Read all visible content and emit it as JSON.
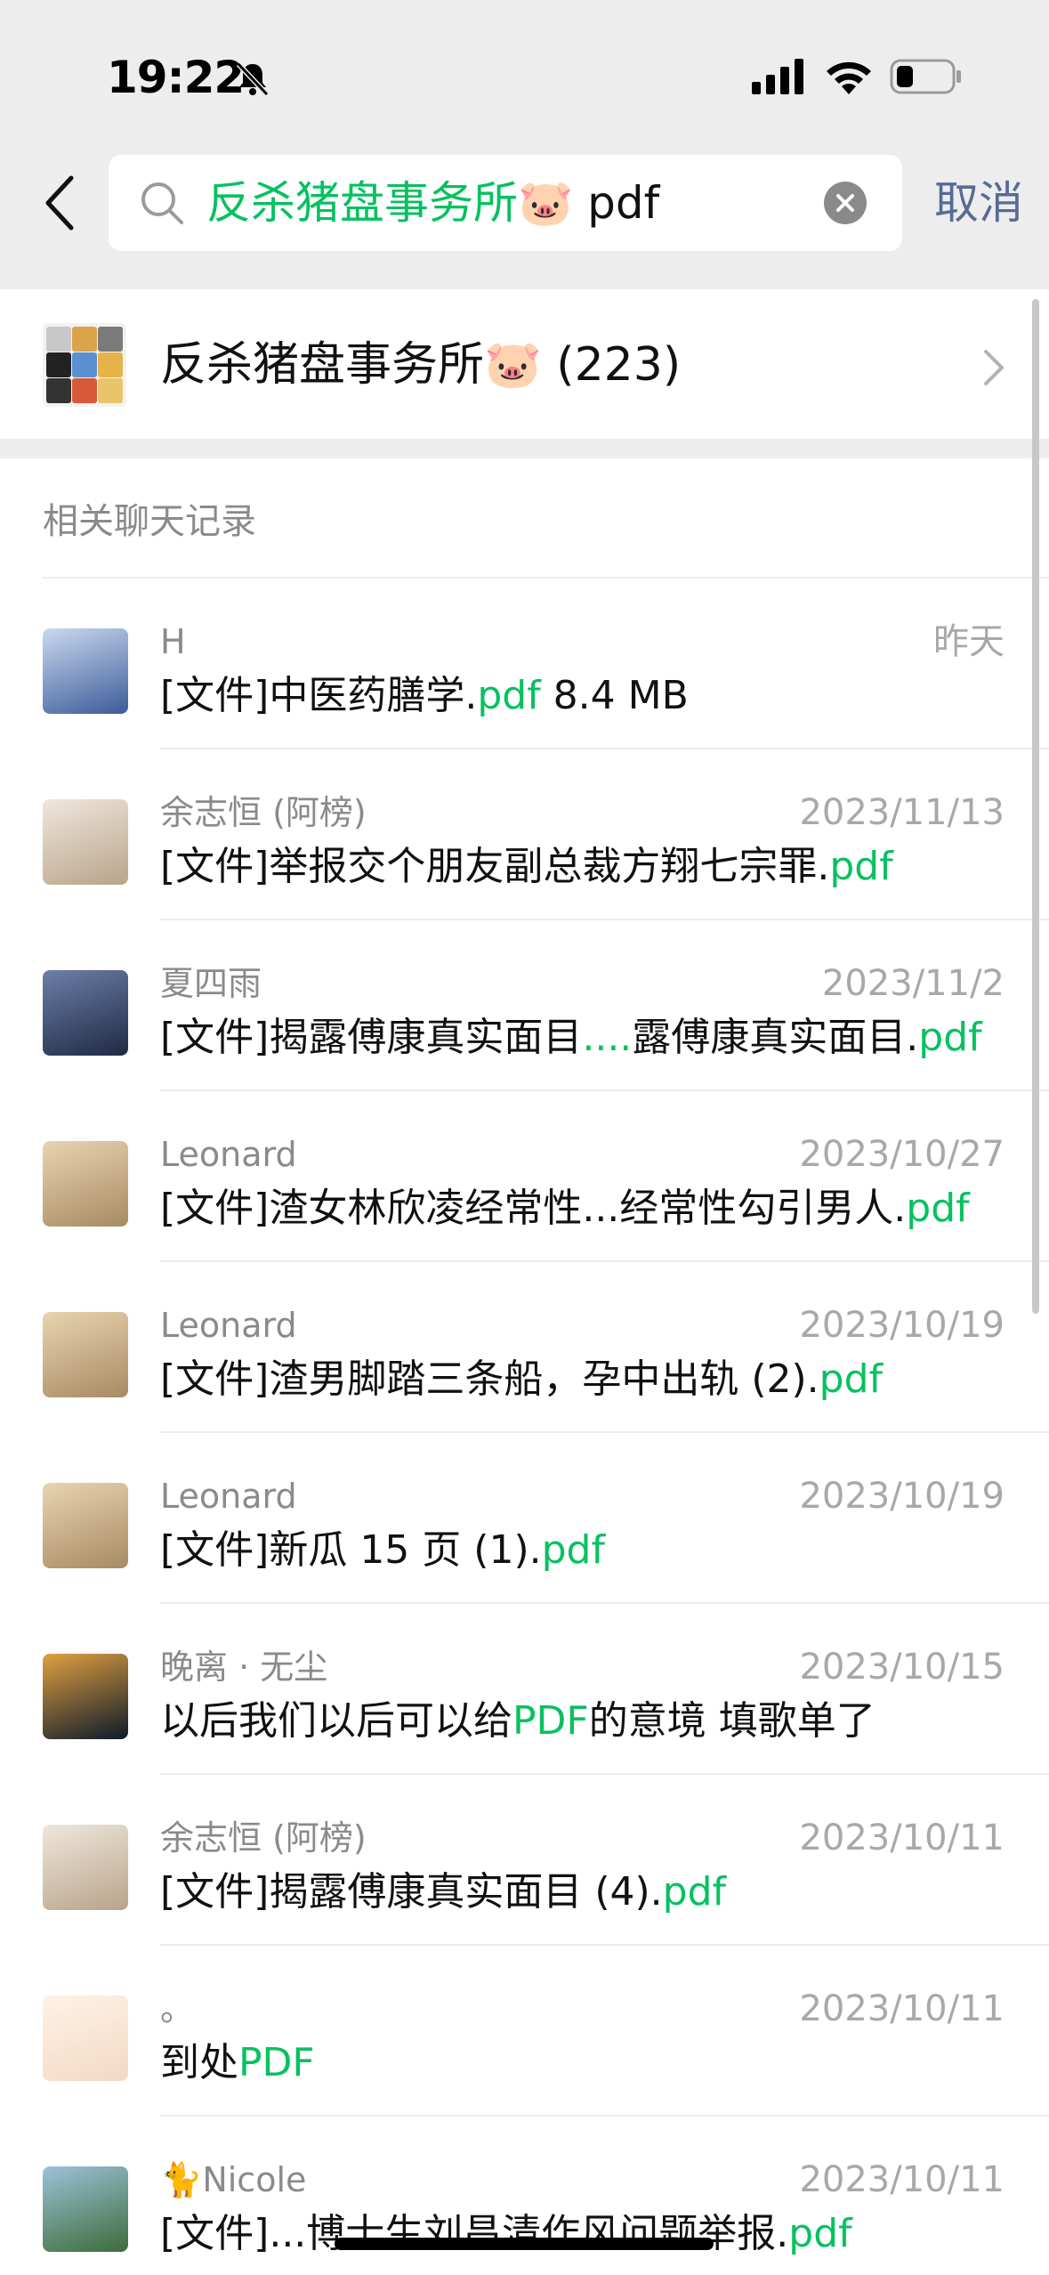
{
  "status_bar": {
    "time": "19:22"
  },
  "search": {
    "query_keyword": "反杀猪盘事务所🐷",
    "query_term": "pdf",
    "cancel_label": "取消"
  },
  "group": {
    "name": "反杀猪盘事务所🐷 (223)"
  },
  "section": {
    "title": "相关聊天记录"
  },
  "results": [
    {
      "sender": "H",
      "date": "昨天",
      "prefix": "[文件]中医药膳学.",
      "highlight": "pdf",
      "suffix": " 8.4 MB",
      "avatar_colors": [
        "#3d5b9a",
        "#c9d9ee"
      ]
    },
    {
      "sender": "余志恒 (阿榜)",
      "date": "2023/11/13",
      "prefix": "[文件]举报交个朋友副总裁方翔七宗罪.",
      "highlight": "pdf",
      "suffix": "",
      "avatar_colors": [
        "#b9a38a",
        "#efe7dc"
      ]
    },
    {
      "sender": "夏四雨",
      "date": "2023/11/2",
      "prefix": "[文件]揭露傅康真实面目",
      "highlight": "....",
      "suffix": "露傅康真实面目.",
      "suffix2_highlight": "pdf",
      "avatar_colors": [
        "#1f2a44",
        "#6c7fa8"
      ]
    },
    {
      "sender": "Leonard",
      "date": "2023/10/27",
      "prefix": "[文件]渣女林欣凌经常性...经常性勾引男人.",
      "highlight": "pdf",
      "suffix": "",
      "avatar_colors": [
        "#a88a62",
        "#e8d4b0"
      ]
    },
    {
      "sender": "Leonard",
      "date": "2023/10/19",
      "prefix": "[文件]渣男脚踏三条船，孕中出轨 (2).",
      "highlight": "pdf",
      "suffix": "",
      "avatar_colors": [
        "#a88a62",
        "#e8d4b0"
      ]
    },
    {
      "sender": "Leonard",
      "date": "2023/10/19",
      "prefix": "[文件]新瓜 15 页 (1).",
      "highlight": "pdf",
      "suffix": "",
      "avatar_colors": [
        "#a88a62",
        "#e8d4b0"
      ]
    },
    {
      "sender": "晚离 · 无尘",
      "date": "2023/10/15",
      "prefix": "以后我们以后可以给",
      "highlight": "PDF",
      "suffix": "的意境 填歌单了",
      "avatar_colors": [
        "#0d1a2b",
        "#e0a040"
      ]
    },
    {
      "sender": "余志恒 (阿榜)",
      "date": "2023/10/11",
      "prefix": "[文件]揭露傅康真实面目 (4).",
      "highlight": "pdf",
      "suffix": "",
      "avatar_colors": [
        "#b9a38a",
        "#efe7dc"
      ]
    },
    {
      "sender": "。",
      "date": "2023/10/11",
      "prefix": "到处",
      "highlight": "PDF",
      "suffix": "",
      "avatar_colors": [
        "#f3d9c4",
        "#fff2e6"
      ]
    },
    {
      "sender": "🐈Nicole",
      "date": "2023/10/11",
      "prefix": "[文件]...博士生刘昌清作风问题举报.",
      "highlight": "pdf",
      "suffix": "",
      "avatar_colors": [
        "#3e6b3a",
        "#9cc2d8"
      ]
    }
  ],
  "icons": {
    "back": "chevron-left-icon",
    "search": "search-icon",
    "clear": "clear-circle-icon",
    "chevron": "chevron-right-icon",
    "mute": "bell-off-icon",
    "signal": "signal-icon",
    "wifi": "wifi-icon",
    "battery": "battery-icon"
  },
  "colors": {
    "highlight": "#07c160",
    "cancel": "#576b95",
    "background": "#ededed"
  }
}
